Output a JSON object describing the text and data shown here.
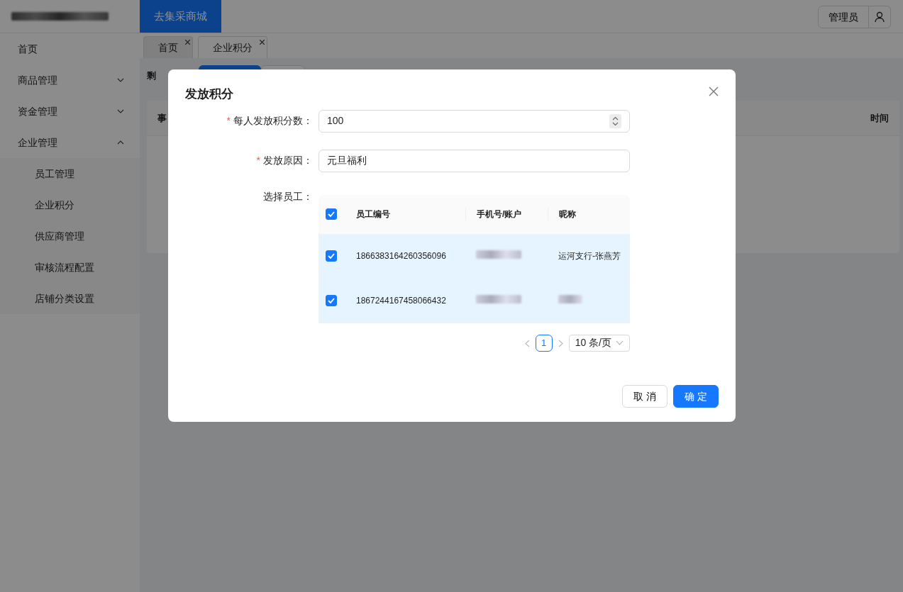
{
  "header": {
    "mall_button": "去集采商城",
    "user_button": "管理员"
  },
  "sidebar": {
    "items": [
      {
        "label": "首页"
      },
      {
        "label": "商品管理",
        "expanded": false
      },
      {
        "label": "资金管理",
        "expanded": false
      },
      {
        "label": "企业管理",
        "expanded": true,
        "children": [
          {
            "label": "员工管理"
          },
          {
            "label": "企业积分"
          },
          {
            "label": "供应商管理"
          },
          {
            "label": "审核流程配置"
          },
          {
            "label": "店铺分类设置"
          }
        ]
      }
    ]
  },
  "tabs": [
    {
      "label": "首页",
      "selected": false
    },
    {
      "label": "企业积分",
      "selected": true
    }
  ],
  "page": {
    "balance_label": "剩",
    "columns": [
      "事",
      "时间"
    ]
  },
  "modal": {
    "title": "发放积分",
    "fields": [
      {
        "kind": "number",
        "required_mark": "*",
        "label": "每人发放积分数：",
        "value": "100"
      },
      {
        "kind": "text",
        "required_mark": "*",
        "label": "发放原因：",
        "value": "元旦福利"
      }
    ],
    "employee_label": "选择员工：",
    "table": {
      "all_checked": true,
      "columns": [
        "员工编号",
        "手机号/账户",
        "昵称"
      ],
      "rows": [
        {
          "selected": true,
          "employee_id": "1866383164260356096",
          "nickname": "运河支行-张燕芳"
        },
        {
          "selected": true,
          "employee_id": "1867244167458066432"
        }
      ]
    },
    "pagination": {
      "current": "1",
      "page_size": "10 条/页"
    },
    "buttons": [
      {
        "kind": "cancel",
        "label": "取 消"
      },
      {
        "kind": "primary",
        "label": "确 定"
      }
    ]
  }
}
